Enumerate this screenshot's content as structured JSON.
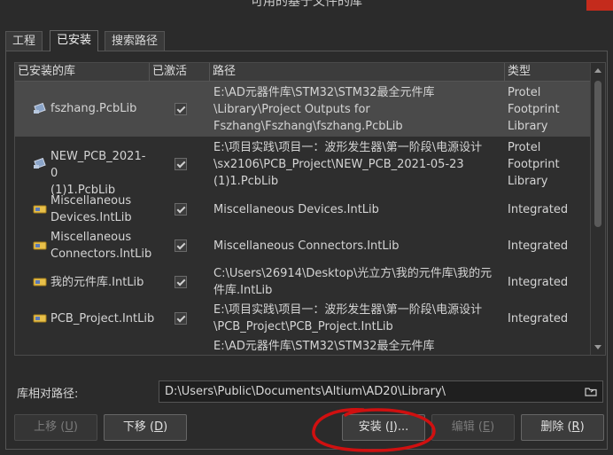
{
  "window": {
    "title": "可用的基于文件的库"
  },
  "tabs": [
    {
      "label": "工程"
    },
    {
      "label": "已安装"
    },
    {
      "label": "搜索路径"
    }
  ],
  "columns": {
    "name": "已安装的库",
    "active": "已激活",
    "path": "路径",
    "type": "类型"
  },
  "libraries": [
    {
      "name": "fszhang.PcbLib",
      "icon": "pcblib-icon",
      "active": true,
      "path": "E:\\AD元器件库\\STM32\\STM32最全元件库\n\\Library\\Project Outputs for\nFszhang\\Fszhang\\fszhang.PcbLib",
      "type": "Protel\nFootprint\nLibrary"
    },
    {
      "name": "NEW_PCB_2021-0\n(1)1.PcbLib",
      "icon": "pcblib-icon",
      "active": true,
      "path": "E:\\项目实践\\项目一：波形发生器\\第一阶段\\电源设计\n\\sx2106\\PCB_Project\\NEW_PCB_2021-05-23\n(1)1.PcbLib",
      "type": "Protel\nFootprint\nLibrary"
    },
    {
      "name": "Miscellaneous\nDevices.IntLib",
      "icon": "intlib-icon",
      "active": true,
      "path": "Miscellaneous Devices.IntLib",
      "type": "Integrated"
    },
    {
      "name": "Miscellaneous\nConnectors.IntLib",
      "icon": "intlib-icon",
      "active": true,
      "path": "Miscellaneous Connectors.IntLib",
      "type": "Integrated"
    },
    {
      "name": "我的元件库.IntLib",
      "icon": "intlib-icon",
      "active": true,
      "path": "C:\\Users\\26914\\Desktop\\光立方\\我的元件库\\我的元\n件库.IntLib",
      "type": "Integrated"
    },
    {
      "name": "PCB_Project.IntLib",
      "icon": "intlib-icon",
      "active": true,
      "path": "E:\\项目实践\\项目一：波形发生器\\第一阶段\\电源设计\n\\PCB_Project\\PCB_Project.IntLib",
      "type": "Integrated"
    },
    {
      "name": "",
      "icon": "",
      "active": false,
      "path": "E:\\AD元器件库\\STM32\\STM32最全元件库",
      "type": ""
    }
  ],
  "relative_path": {
    "label": "库相对路径:",
    "value": "D:\\Users\\Public\\Documents\\Altium\\AD20\\Library\\"
  },
  "buttons": {
    "move_up": {
      "label": "上移 (",
      "key": "U",
      "tail": ")"
    },
    "move_down": {
      "label": "下移 (",
      "key": "D",
      "tail": ")"
    },
    "install": {
      "label": "安装 (",
      "key": "I",
      "tail": ")..."
    },
    "edit": {
      "label": "编辑 (",
      "key": "E",
      "tail": ")"
    },
    "remove": {
      "label": "删除 (",
      "key": "R",
      "tail": ")"
    }
  },
  "colors": {
    "background": "#2b2b2b",
    "selected_row": "#4a4a4a",
    "annotation": "#d01010"
  }
}
